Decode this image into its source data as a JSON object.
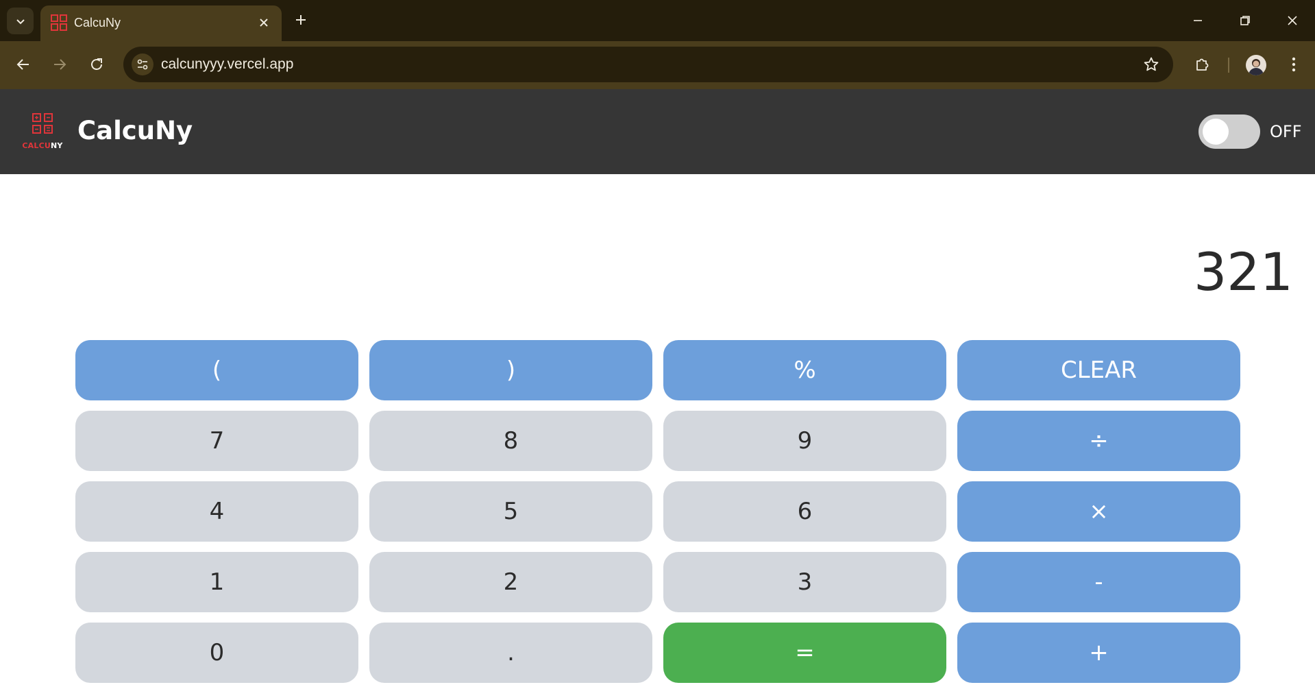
{
  "browser": {
    "tab_title": "CalcuNy",
    "url": "calcunyyy.vercel.app",
    "icons": {
      "tab_search": "chevron-down-icon",
      "tab_close": "close-icon",
      "new_tab": "plus-icon",
      "back": "arrow-left-icon",
      "forward": "arrow-right-icon",
      "reload": "reload-icon",
      "site_info": "tune-icon",
      "bookmark": "star-icon",
      "extensions": "puzzle-icon",
      "menu": "kebab-menu-icon"
    }
  },
  "header": {
    "logo_text_red": "CALCU",
    "logo_text_white": "NY",
    "title": "CalcuNy",
    "toggle_label": "OFF",
    "toggle_on": false
  },
  "display": {
    "value": "321"
  },
  "keys": [
    {
      "label": "(",
      "kind": "op"
    },
    {
      "label": ")",
      "kind": "op"
    },
    {
      "label": "%",
      "kind": "op"
    },
    {
      "label": "CLEAR",
      "kind": "op"
    },
    {
      "label": "7",
      "kind": "num"
    },
    {
      "label": "8",
      "kind": "num"
    },
    {
      "label": "9",
      "kind": "num"
    },
    {
      "label": "÷",
      "kind": "op"
    },
    {
      "label": "4",
      "kind": "num"
    },
    {
      "label": "5",
      "kind": "num"
    },
    {
      "label": "6",
      "kind": "num"
    },
    {
      "label": "×",
      "kind": "op"
    },
    {
      "label": "1",
      "kind": "num"
    },
    {
      "label": "2",
      "kind": "num"
    },
    {
      "label": "3",
      "kind": "num"
    },
    {
      "label": "-",
      "kind": "op"
    },
    {
      "label": "0",
      "kind": "num"
    },
    {
      "label": ".",
      "kind": "num"
    },
    {
      "label": "=",
      "kind": "eq"
    },
    {
      "label": "+",
      "kind": "op"
    }
  ],
  "colors": {
    "operator": "#6d9fdb",
    "number": "#d3d7dd",
    "equals": "#4caf50",
    "header": "#363636",
    "logo_red": "#e0353a"
  }
}
